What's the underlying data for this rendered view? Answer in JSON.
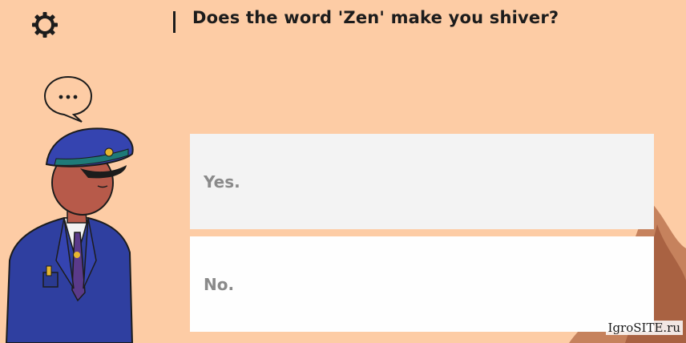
{
  "dialog": {
    "question": "Does the word 'Zen' make you shiver?",
    "speaker_bubble": "..."
  },
  "choices": [
    {
      "label": "Yes."
    },
    {
      "label": "No."
    }
  ],
  "settings": {
    "icon": "gear-icon"
  },
  "watermark": "IgroSITE.ru",
  "colors": {
    "background": "#fdcca5",
    "choice_yes_bg": "#f3f3f3",
    "choice_no_bg": "#fefefe",
    "choice_text": "#8a8a8a",
    "text_dark": "#1c1c1c",
    "uniform_blue": "#2f3fa0",
    "skin": "#b75a4a"
  }
}
